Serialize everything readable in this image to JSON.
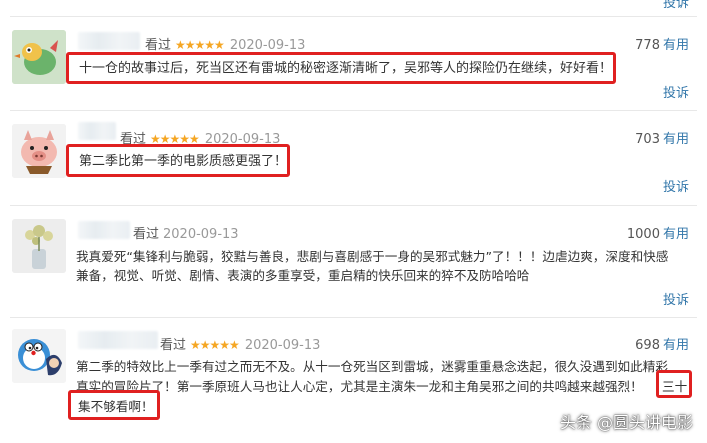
{
  "top_report": "投诉",
  "reviews": [
    {
      "watched": "看过",
      "stars": "★★★★★",
      "date": "2020-09-13",
      "votes": "778",
      "useful": "有用",
      "content": "十一仓的故事过后，死当区还有雷城的秘密逐渐清晰了，吴邪等人的探险仍在继续，好好看！",
      "report": "投诉",
      "avatar": "bird-cartoon-avatar"
    },
    {
      "watched": "看过",
      "stars": "★★★★★",
      "date": "2020-09-13",
      "votes": "703",
      "useful": "有用",
      "content": "第二季比第一季的电影质感更强了！",
      "report": "投诉",
      "avatar": "pig-cartoon-avatar"
    },
    {
      "watched": "看过",
      "stars": "",
      "date": "2020-09-13",
      "votes": "1000",
      "useful": "有用",
      "content_line1": "我真爱死“集锋利与脆弱，狡黠与善良，悲剧与喜剧感于一身的吴邪式魅力”了！！！边虐边爽，深度和快感",
      "content_line2": "兼备，视觉、听觉、剧情、表演的多重享受，重启精的快乐回来的猝不及防哈哈哈",
      "report": "投诉",
      "avatar": "flower-vase-avatar"
    },
    {
      "watched": "看过",
      "stars": "★★★★★",
      "date": "2020-09-13",
      "votes": "698",
      "useful": "有用",
      "content_line1": "第二季的特效比上一季有过之而无不及。从十一仓死当区到雷城，迷雾重重悬念迭起，很久没遇到如此精彩",
      "content_line2a": "真实的冒险片了！第一季原班人马也让人心定，尤其是主演朱一龙和主角吴邪之间的共鸣越来越强烈！",
      "content_line2b": "三十",
      "content_line3": "集不够看啊！",
      "avatar": "doraemon-cartoon-avatar"
    }
  ],
  "watermark": "头条 @圆头讲电影",
  "colors": {
    "link": "#3377aa",
    "star": "#f5a623",
    "highlight": "#e02020"
  }
}
